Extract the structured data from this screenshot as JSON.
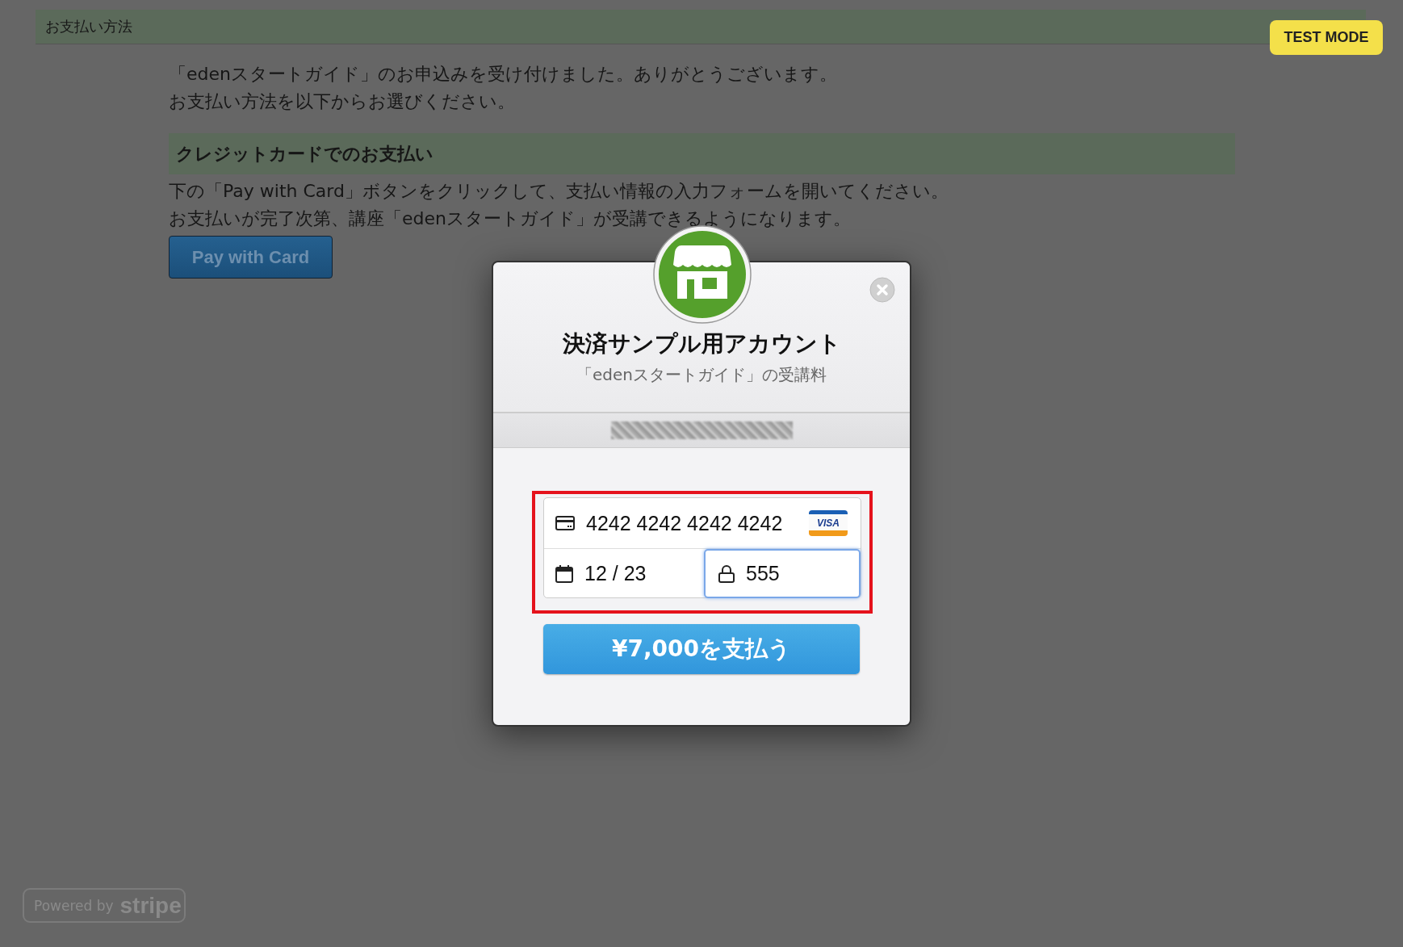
{
  "page_header": {
    "title": "お支払い方法"
  },
  "test_mode_badge": "TEST MODE",
  "intro": [
    "「edenスタートガイド」のお申込みを受け付けました。ありがとうございます。",
    "お支払い方法を以下からお選びください。"
  ],
  "section": {
    "heading": "クレジットカードでのお支払い",
    "lines": [
      "下の「Pay with Card」ボタンをクリックして、支払い情報の入力フォームを開いてください。",
      "お支払いが完了次第、講座「edenスタートガイド」が受講できるようになります。"
    ],
    "button": "Pay with Card"
  },
  "checkout": {
    "title": "決済サンプル用アカウント",
    "subtitle": "「edenスタートガイド」の受講料",
    "card_number": "4242 4242 4242 4242",
    "card_brand": "VISA",
    "expiry": "12 / 23",
    "cvc": "555",
    "cvc_focused": true,
    "pay_button": "¥7,000を支払う"
  },
  "footer": {
    "powered_by": "Powered by",
    "brand": "stripe"
  }
}
